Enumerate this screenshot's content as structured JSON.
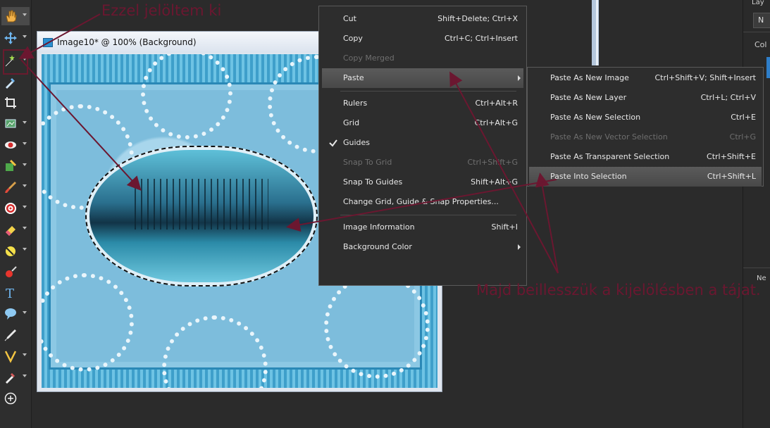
{
  "image_window": {
    "title": "Image10* @ 100% (Background)"
  },
  "context_menu": {
    "items": [
      {
        "label": "Cut",
        "shortcut": "Shift+Delete; Ctrl+X"
      },
      {
        "label": "Copy",
        "shortcut": "Ctrl+C; Ctrl+Insert"
      },
      {
        "label": "Copy Merged",
        "shortcut": ""
      },
      {
        "label": "Paste",
        "shortcut": ""
      },
      {
        "label": "Rulers",
        "shortcut": "Ctrl+Alt+R"
      },
      {
        "label": "Grid",
        "shortcut": "Ctrl+Alt+G"
      },
      {
        "label": "Guides",
        "shortcut": ""
      },
      {
        "label": "Snap To Grid",
        "shortcut": "Ctrl+Shift+G"
      },
      {
        "label": "Snap To Guides",
        "shortcut": "Shift+Alt+G"
      },
      {
        "label": "Change Grid, Guide & Snap Properties...",
        "shortcut": ""
      },
      {
        "label": "Image Information",
        "shortcut": "Shift+I"
      },
      {
        "label": "Background Color",
        "shortcut": ""
      }
    ]
  },
  "paste_submenu": {
    "items": [
      {
        "label": "Paste As New Image",
        "shortcut": "Ctrl+Shift+V; Shift+Insert"
      },
      {
        "label": "Paste As New Layer",
        "shortcut": "Ctrl+L; Ctrl+V"
      },
      {
        "label": "Paste As New Selection",
        "shortcut": "Ctrl+E"
      },
      {
        "label": "Paste As New Vector Selection",
        "shortcut": "Ctrl+G"
      },
      {
        "label": "Paste As Transparent Selection",
        "shortcut": "Ctrl+Shift+E"
      },
      {
        "label": "Paste Into Selection",
        "shortcut": "Ctrl+Shift+L"
      }
    ]
  },
  "right_panel": {
    "label_top": "Lay",
    "button": "N",
    "label_col": "Col",
    "label_bottom": "Ne"
  },
  "annotations": {
    "top": "Ezzel jelöltem ki",
    "bottom": "Majd beillesszük a kijelölésben a tájat."
  },
  "colors": {
    "annotation": "#6b1730",
    "menu_bg": "#2d2d2d",
    "highlight": "#555555"
  },
  "toolbar_icons": [
    "pan-tool-icon",
    "move-tool-icon",
    "magic-wand-icon",
    "eyedropper-icon",
    "crop-icon",
    "picture-tube-icon",
    "red-eye-icon",
    "flood-fill-icon",
    "paint-brush-icon",
    "target-icon",
    "eraser-icon",
    "dodge-icon",
    "color-replacer-icon",
    "text-tool-icon",
    "speech-balloon-icon",
    "pen-tool-icon",
    "draw-tool-icon",
    "dropper-icon",
    "add-icon"
  ]
}
